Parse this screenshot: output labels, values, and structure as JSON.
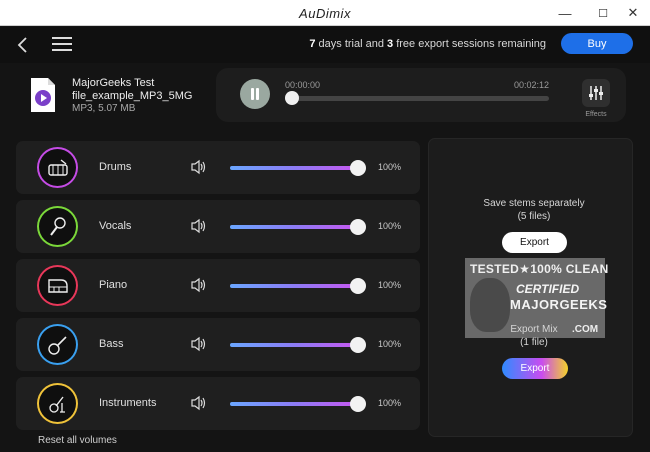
{
  "app": {
    "title": "AuDimix"
  },
  "window": {
    "minimize": "—",
    "maximize": "☐",
    "close": "✕"
  },
  "header": {
    "trial_days": "7",
    "trial_text_1": " days trial and ",
    "trial_sessions": "3",
    "trial_text_2": " free export sessions remaining",
    "buy_label": "Buy"
  },
  "file": {
    "name_line1": "MajorGeeks Test",
    "name_line2": "file_example_MP3_5MG",
    "meta": "MP3, 5.07 MB"
  },
  "player": {
    "current_time": "00:00:00",
    "total_time": "00:02:12",
    "progress": 0.0,
    "effects_label": "Effects"
  },
  "stems": [
    {
      "name": "Drums",
      "volume_label": "100%",
      "volume": 100,
      "color": "#c54ce6",
      "icon": "drum-icon"
    },
    {
      "name": "Vocals",
      "volume_label": "100%",
      "volume": 100,
      "color": "#7bd83a",
      "icon": "microphone-icon"
    },
    {
      "name": "Piano",
      "volume_label": "100%",
      "volume": 100,
      "color": "#e8385a",
      "icon": "piano-icon"
    },
    {
      "name": "Bass",
      "volume_label": "100%",
      "volume": 100,
      "color": "#3aa0f0",
      "icon": "guitar-icon"
    },
    {
      "name": "Instruments",
      "volume_label": "100%",
      "volume": 100,
      "color": "#f0c33a",
      "icon": "instruments-icon"
    }
  ],
  "reset_label": "Reset all volumes",
  "export": {
    "stems_title": "Save stems separately",
    "stems_count": "(5 files)",
    "stems_button": "Export",
    "mix_title": "Export Mix",
    "mix_count": "(1 file)",
    "mix_button": "Export"
  },
  "watermark": {
    "top": "TESTED★100% CLEAN",
    "mid": "CERTIFIED",
    "bot": "MAJORGEEKS",
    "com": ".COM"
  }
}
